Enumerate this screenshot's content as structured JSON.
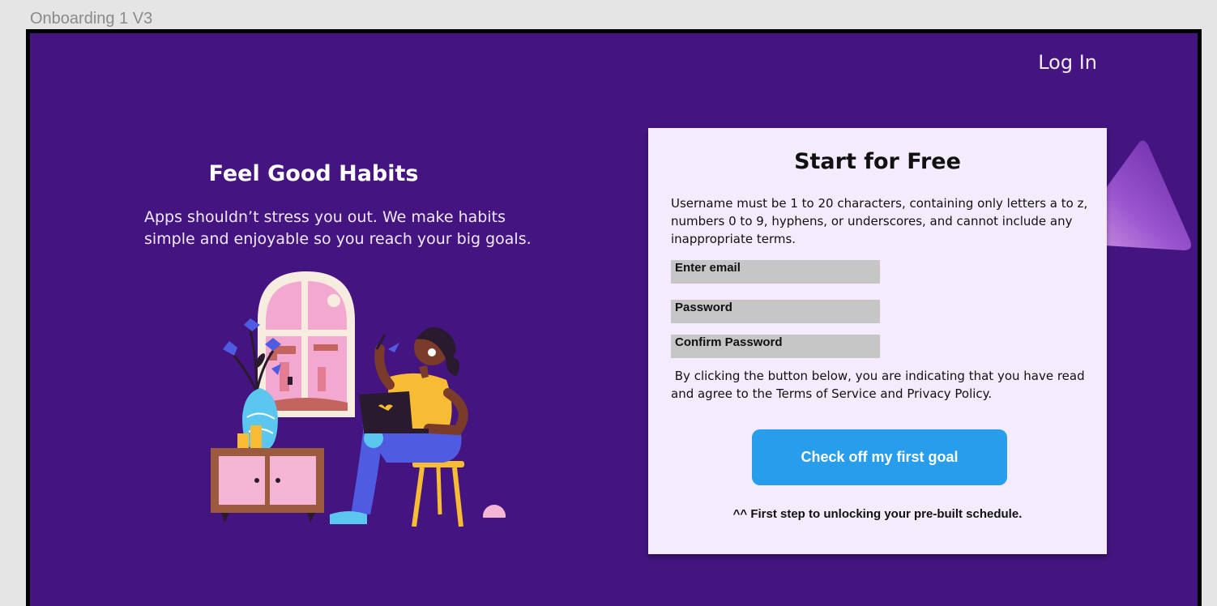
{
  "frame": {
    "label": "Onboarding 1 V3"
  },
  "header": {
    "login_label": "Log In"
  },
  "hero": {
    "title": "Feel Good Habits",
    "text_line1": "Apps shouldn’t stress you out. We make habits",
    "text_line2": "simple and enjoyable so you reach your big goals."
  },
  "signup": {
    "title": "Start for Free",
    "hint_line1": "Username must be 1 to 20 characters, containing only letters a to z,",
    "hint_line2": "numbers 0 to 9, hyphens, or underscores, and cannot include any",
    "hint_line3": "inappropriate terms.",
    "email_label": "Enter email",
    "password_label": "Password",
    "confirm_label": "Confirm Password",
    "terms_line1": " By clicking the button below, you are indicating that you have read",
    "terms_line2": "and agree to the Terms of Service and Privacy Policy.",
    "cta_label": "Check off my first goal",
    "footnote": "^^ First step to unlocking your pre-built schedule."
  },
  "colors": {
    "background": "#441580",
    "card": "#f4ecfc",
    "cta": "#279deb",
    "field": "#c6c6c6"
  }
}
